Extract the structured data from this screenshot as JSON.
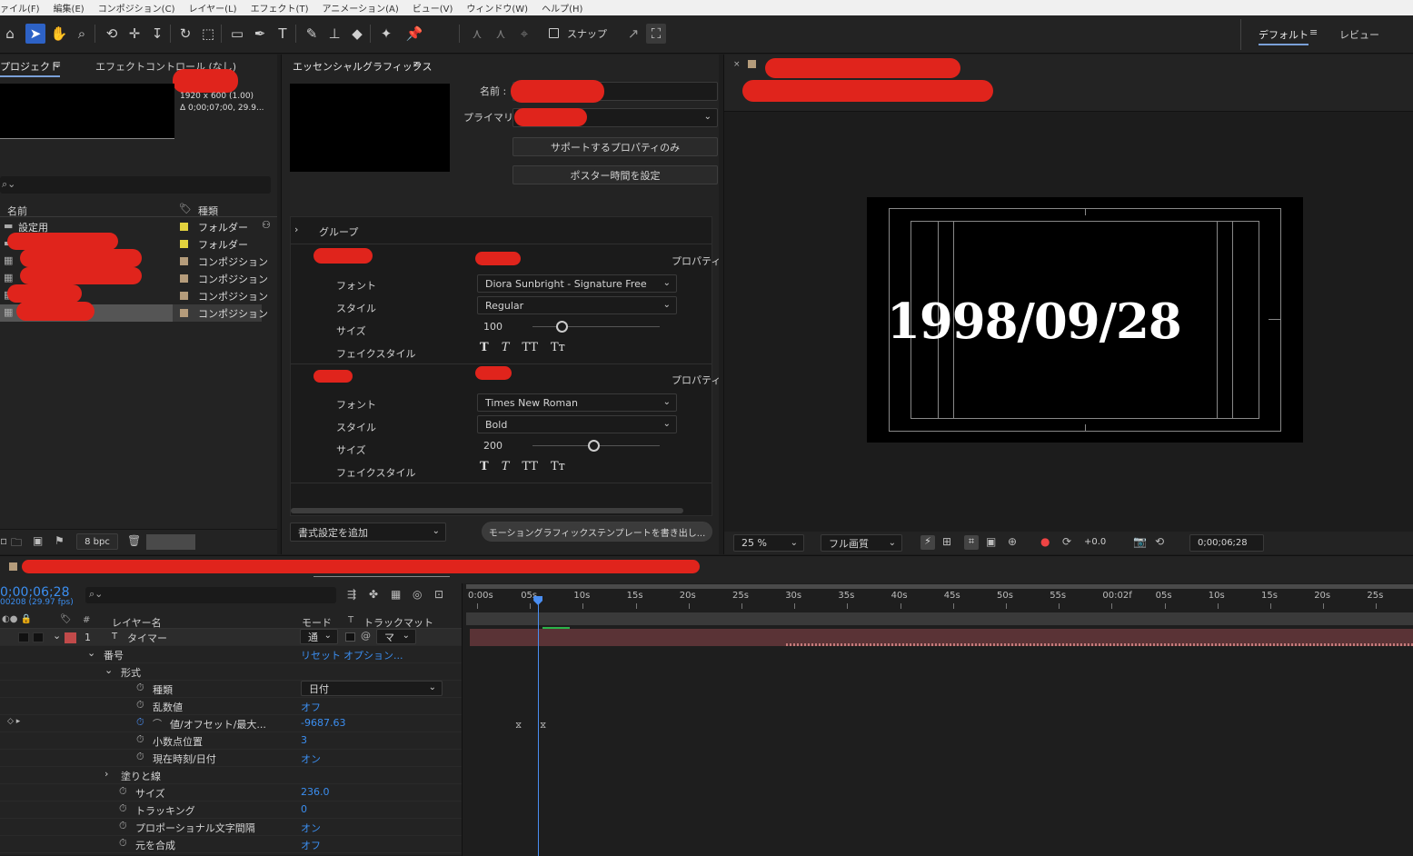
{
  "menu": [
    "ァイル(F)",
    "編集(E)",
    "コンポジション(C)",
    "レイヤー(L)",
    "エフェクト(T)",
    "アニメーション(A)",
    "ビュー(V)",
    "ウィンドウ(W)",
    "ヘルプ(H)"
  ],
  "toolbar": {
    "snap_label": "スナップ",
    "workspace_default": "デフォルト",
    "workspace_review": "レビュー"
  },
  "project": {
    "tab_label": "プロジェクト",
    "effects_tab": "エフェクトコントロール (なし)",
    "comp_info_size": "1920 x 600 (1.00)",
    "comp_info_duration": "Δ 0;00;07;00, 29.9...",
    "col_name": "名前",
    "col_type": "種類",
    "items": [
      {
        "name": "設定用",
        "type": "フォルダー",
        "color": "#e3d33e"
      },
      {
        "name": "",
        "type": "フォルダー",
        "color": "#e3d33e"
      },
      {
        "name": "",
        "type": "コンポジション",
        "color": "#b59c7b"
      },
      {
        "name": "",
        "type": "コンポジション",
        "color": "#b59c7b"
      },
      {
        "name": "",
        "type": "コンポジション",
        "color": "#b59c7b"
      },
      {
        "name": "",
        "type": "コンポジション",
        "color": "#b59c7b"
      }
    ],
    "bpc": "8 bpc"
  },
  "eg": {
    "title": "エッセンシャルグラフィックス",
    "name_label": "名前 :",
    "primary_label": "プライマリ :",
    "btn_supported": "サポートするプロパティのみ",
    "btn_poster": "ポスター時間を設定",
    "group_label": "グループ",
    "props_label": "プロパティ",
    "font_label": "フォント",
    "style_label": "スタイル",
    "size_label": "サイズ",
    "fontstyle_label": "フェイクスタイル",
    "block1": {
      "font": "Diora Sunbright - Signature Free",
      "style": "Regular",
      "size": "100",
      "slider": 0.23
    },
    "block2": {
      "font": "Times New Roman",
      "style": "Bold",
      "size": "200",
      "slider": 0.48
    },
    "fake_styles": [
      "T",
      "T",
      "TT",
      "Tт"
    ],
    "add_format": "書式設定を追加",
    "export_btn": "モーショングラフィックステンプレートを書き出し..."
  },
  "viewer": {
    "comp_text": "1998/09/28",
    "zoom": "25 %",
    "quality": "フル画質",
    "exposure": "+0.0",
    "timecode": "0;00;06;28"
  },
  "timeline": {
    "timecode": "0;00;06;28",
    "frames": "00208 (29.97 fps)",
    "col_layer_name": "レイヤー名",
    "col_mode": "モード",
    "col_trackmatte": "トラックマット",
    "ruler": [
      "0:00s",
      "05s",
      "10s",
      "15s",
      "20s",
      "25s",
      "30s",
      "35s",
      "40s",
      "45s",
      "50s",
      "55s",
      "00:02f",
      "05s",
      "10s",
      "15s",
      "20s",
      "25s"
    ],
    "layer": {
      "num": "1",
      "name": "タイマー",
      "mode": "通",
      "matte": "マ"
    },
    "rows": [
      {
        "label": "番号",
        "value": "リセット",
        "extra": "オプション...",
        "indent": 1,
        "twirl": "down"
      },
      {
        "label": "形式",
        "value": "",
        "indent": 2,
        "twirl": "down"
      },
      {
        "label": "種類",
        "value": "日付",
        "indent": 3,
        "stopwatch": true,
        "dropdown": true
      },
      {
        "label": "乱数値",
        "value": "オフ",
        "indent": 3,
        "stopwatch": true
      },
      {
        "label": "値/オフセット/最大...",
        "value": "-9687.63",
        "indent": 3,
        "stopwatch": true,
        "keyed": true
      },
      {
        "label": "小数点位置",
        "value": "3",
        "indent": 3,
        "stopwatch": true
      },
      {
        "label": "現在時刻/日付",
        "value": "オン",
        "indent": 3,
        "stopwatch": true
      },
      {
        "label": "塗りと線",
        "value": "",
        "indent": 2,
        "twirl": "right"
      },
      {
        "label": "サイズ",
        "value": "236.0",
        "indent": 2,
        "stopwatch": true
      },
      {
        "label": "トラッキング",
        "value": "0",
        "indent": 2,
        "stopwatch": true
      },
      {
        "label": "プロポーショナル文字間隔",
        "value": "オン",
        "indent": 2,
        "stopwatch": true
      },
      {
        "label": "元を合成",
        "value": "オフ",
        "indent": 2,
        "stopwatch": true
      }
    ],
    "playhead_fraction": 0.0794
  }
}
